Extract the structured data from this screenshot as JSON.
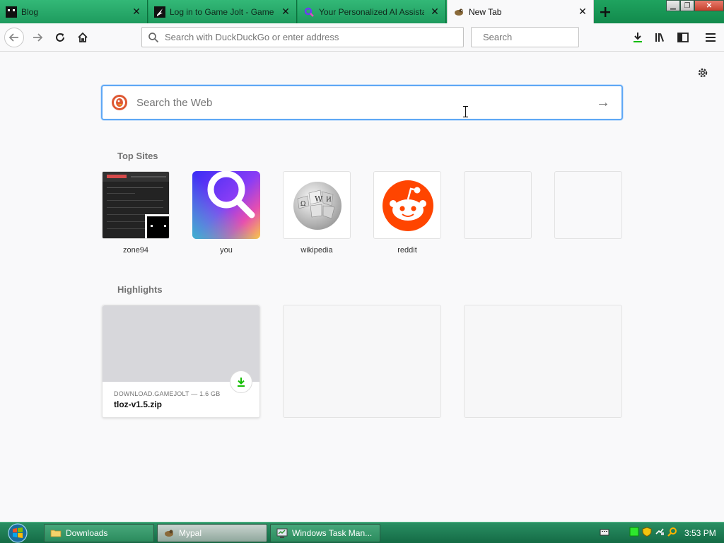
{
  "tabs": [
    {
      "title": "Blog",
      "favicon": "blog-favicon",
      "active": false
    },
    {
      "title": "Log in to Game Jolt - Game Jolt",
      "favicon": "gamejolt-favicon",
      "active": false
    },
    {
      "title": "Your Personalized AI Assistant",
      "favicon": "you-favicon",
      "active": false
    },
    {
      "title": "New Tab",
      "favicon": "mypal-favicon",
      "active": true
    }
  ],
  "toolbar": {
    "url_placeholder": "Search with DuckDuckGo or enter address",
    "search_placeholder": "Search",
    "icons": [
      "back-icon",
      "forward-icon",
      "reload-icon",
      "home-icon",
      "downloads-icon",
      "library-icon",
      "sidebar-icon",
      "menu-icon"
    ]
  },
  "newtab": {
    "search_placeholder": "Search the Web",
    "top_sites_title": "Top Sites",
    "top_sites": [
      {
        "label": "zone94"
      },
      {
        "label": "you"
      },
      {
        "label": "wikipedia"
      },
      {
        "label": "reddit"
      },
      {
        "label": ""
      },
      {
        "label": ""
      }
    ],
    "highlights_title": "Highlights",
    "highlights": [
      {
        "source": "DOWNLOAD.GAMEJOLT — 1.6 GB",
        "filename": "tloz-v1.5.zip"
      }
    ]
  },
  "taskbar": {
    "buttons": [
      {
        "label": "Downloads",
        "icon": "folder-icon"
      },
      {
        "label": "Mypal",
        "icon": "mypal-icon"
      },
      {
        "label": "Windows Task Man...",
        "icon": "task-manager-icon"
      }
    ],
    "clock": "3:53 PM"
  },
  "colors": {
    "accent": "#0a84ff",
    "tabstrip": "#1fa35f",
    "reddit": "#ff4500",
    "download_green": "#12bc00"
  }
}
